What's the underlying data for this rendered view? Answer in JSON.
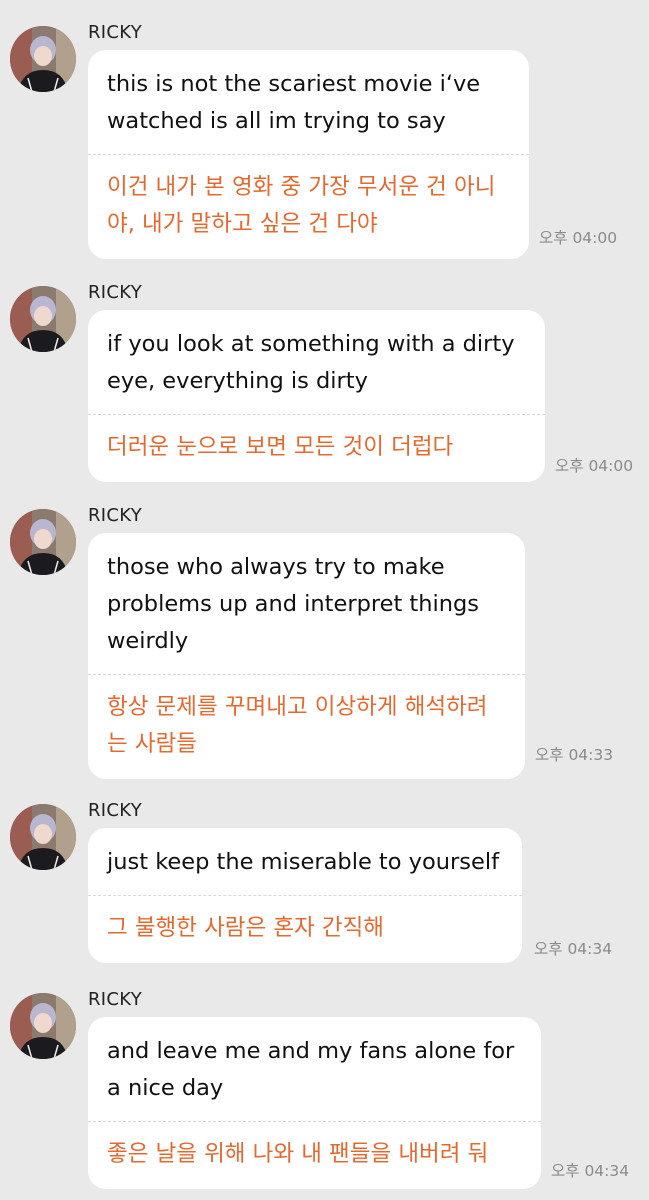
{
  "messages": [
    {
      "sender": "RICKY",
      "english": [
        "this is not the scariest movie i‘ve",
        "watched is all im trying to say"
      ],
      "korean": [
        "이건 내가 본 영화 중 가장 무서운 건 아니",
        "야, 내가 말하고 싶은 건 다야"
      ],
      "time": "오후 04:00"
    },
    {
      "sender": "RICKY",
      "english": [
        "if you look at something with a dirty",
        "eye, everything is dirty"
      ],
      "korean": [
        "더러운 눈으로 보면 모든 것이 더럽다"
      ],
      "time": "오후 04:00"
    },
    {
      "sender": "RICKY",
      "english": [
        "those who always try to make",
        "problems up and interpret things",
        "weirdly"
      ],
      "korean": [
        "항상 문제를 꾸며내고 이상하게 해석하려",
        "는 사람들"
      ],
      "time": "오후 04:33"
    },
    {
      "sender": "RICKY",
      "english": [
        "just keep the miserable to yourself"
      ],
      "korean": [
        "그 불행한 사람은 혼자 간직해"
      ],
      "time": "오후 04:34"
    },
    {
      "sender": "RICKY",
      "english": [
        "and leave me and my fans alone for",
        "a nice day"
      ],
      "korean": [
        "좋은 날을 위해 나와 내 팬들을 내버려 둬"
      ],
      "time": "오후 04:34"
    }
  ],
  "colors": {
    "background": "#e9e9e9",
    "bubble": "#ffffff",
    "translation_text": "#e4692f",
    "timestamp_text": "#8a8a8a"
  },
  "icons": {
    "avatar": "profile-photo-avatar"
  }
}
